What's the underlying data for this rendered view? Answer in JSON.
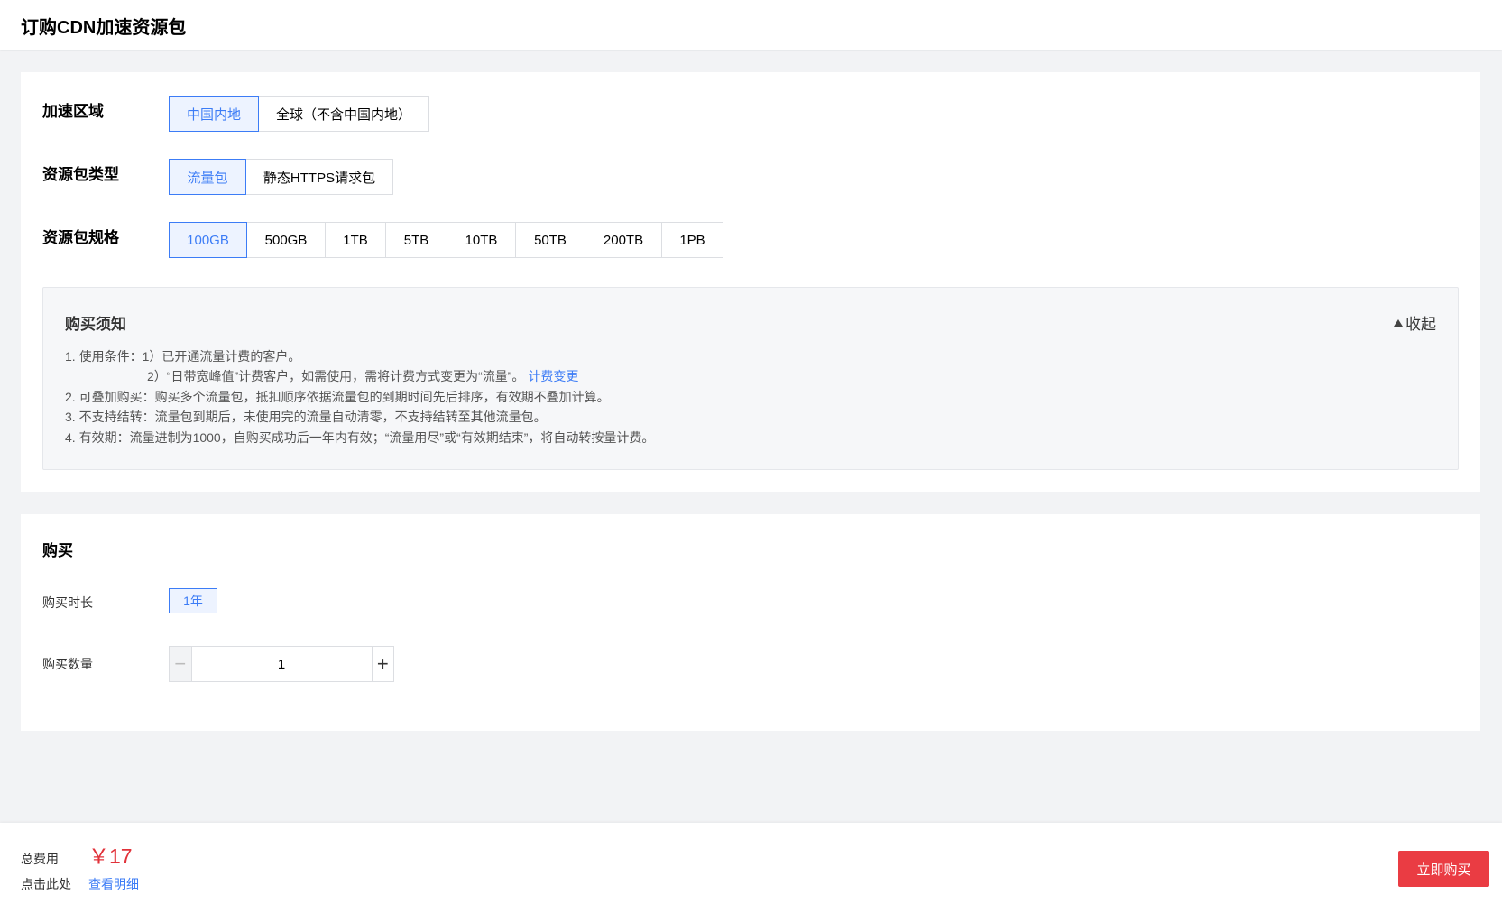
{
  "page": {
    "title": "订购CDN加速资源包"
  },
  "region": {
    "label": "加速区域",
    "options": [
      "中国内地",
      "全球（不含中国内地）"
    ]
  },
  "pkg_type": {
    "label": "资源包类型",
    "options": [
      "流量包",
      "静态HTTPS请求包"
    ]
  },
  "pkg_spec": {
    "label": "资源包规格",
    "options": [
      "100GB",
      "500GB",
      "1TB",
      "5TB",
      "10TB",
      "50TB",
      "200TB",
      "1PB"
    ]
  },
  "notice": {
    "title": "购买须知",
    "collapse": "收起",
    "line1": "1. 使用条件：1）已开通流量计费的客户。",
    "line2_text": "2）“日带宽峰值”计费客户，如需使用，需将计费方式变更为“流量”。",
    "line2_link": "计费变更",
    "line3": "2. 可叠加购买：购买多个流量包，抵扣顺序依据流量包的到期时间先后排序，有效期不叠加计算。",
    "line4": "3. 不支持结转：流量包到期后，未使用完的流量自动清零，不支持结转至其他流量包。",
    "line5": "4. 有效期：流量进制为1000，自购买成功后一年内有效；“流量用尽”或“有效期结束”，将自动转按量计费。"
  },
  "purchase": {
    "title": "购买",
    "duration_label": "购买时长",
    "duration_value": "1年",
    "quantity_label": "购买数量",
    "quantity_value": "1",
    "minus": "−",
    "plus": "+"
  },
  "footer": {
    "total_label": "总费用",
    "price": "￥17",
    "click_label": "点击此处",
    "detail_link": "查看明细",
    "buy_button": "立即购买"
  },
  "colors": {
    "accent": "#3c7cf6",
    "danger": "#ea3c43",
    "price": "#e1323a"
  }
}
